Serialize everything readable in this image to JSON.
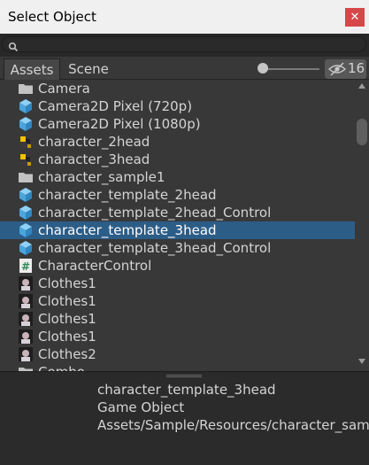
{
  "window": {
    "title": "Select Object",
    "close_glyph": "✕"
  },
  "search": {
    "value": "",
    "placeholder": ""
  },
  "tabs": [
    {
      "label": "Assets",
      "active": true
    },
    {
      "label": "Scene",
      "active": false
    }
  ],
  "toolbar": {
    "zoom_level": 0.0,
    "hidden_count": "16"
  },
  "list": {
    "items": [
      {
        "label": "Camera",
        "icon": "folder-icon"
      },
      {
        "label": "Camera2D Pixel (720p)",
        "icon": "prefab-icon"
      },
      {
        "label": "Camera2D Pixel (1080p)",
        "icon": "prefab-icon"
      },
      {
        "label": "character_2head",
        "icon": "sprite-thumbnail-icon"
      },
      {
        "label": "character_3head",
        "icon": "sprite-thumbnail-icon"
      },
      {
        "label": "character_sample1",
        "icon": "folder-icon"
      },
      {
        "label": "character_template_2head",
        "icon": "prefab-icon"
      },
      {
        "label": "character_template_2head_Control",
        "icon": "prefab-icon"
      },
      {
        "label": "character_template_3head",
        "icon": "prefab-icon",
        "selected": true
      },
      {
        "label": "character_template_3head_Control",
        "icon": "prefab-icon"
      },
      {
        "label": "CharacterControl",
        "icon": "script-icon"
      },
      {
        "label": "Clothes1",
        "icon": "texture-thumbnail-icon"
      },
      {
        "label": "Clothes1",
        "icon": "texture-thumbnail-icon"
      },
      {
        "label": "Clothes1",
        "icon": "texture-thumbnail-icon"
      },
      {
        "label": "Clothes1",
        "icon": "texture-thumbnail-icon"
      },
      {
        "label": "Clothes2",
        "icon": "texture-thumbnail-icon"
      },
      {
        "label": "Combo",
        "icon": "folder-icon"
      }
    ]
  },
  "preview": {
    "name": "character_template_3head",
    "type": "Game Object",
    "path": "Assets/Sample/Resources/character_sam"
  },
  "colors": {
    "selection": "#2c5d87",
    "background": "#383838",
    "close": "#d6474a"
  }
}
